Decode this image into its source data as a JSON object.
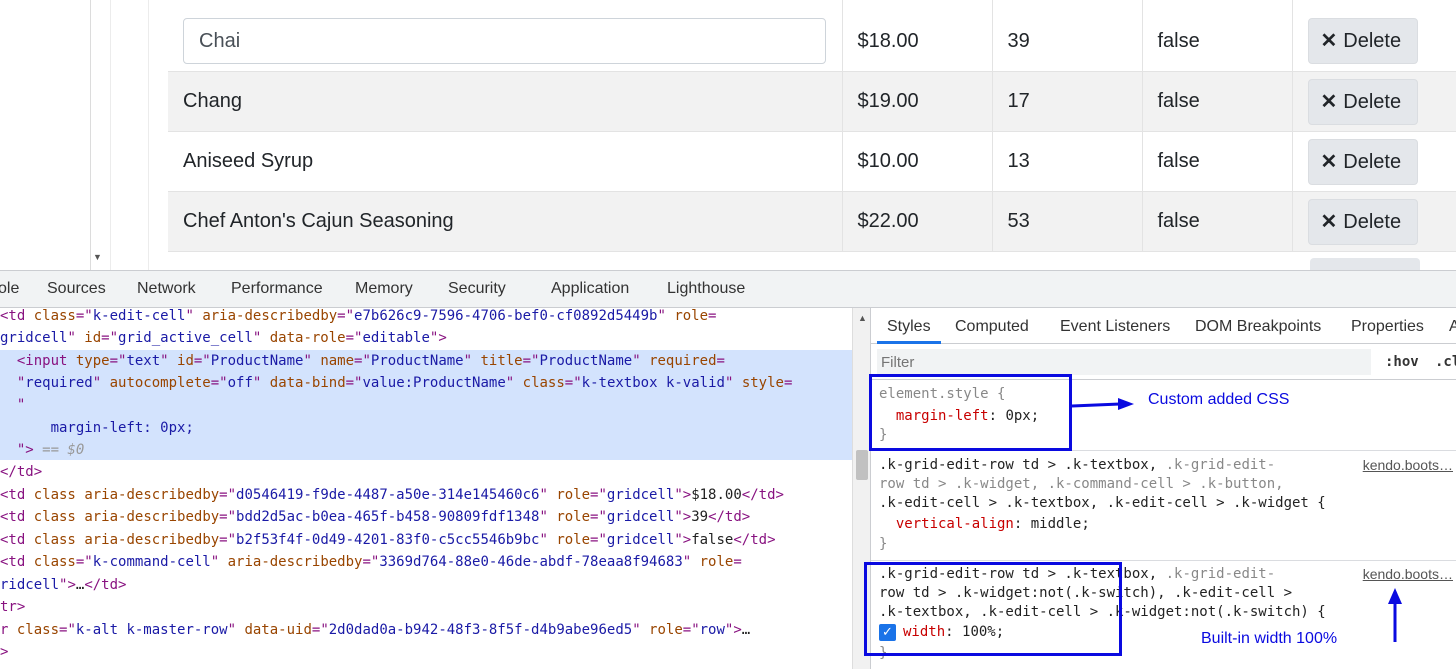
{
  "grid": {
    "rows": [
      {
        "name": "Chai",
        "price": "$18.00",
        "stock": "39",
        "discontinued": "false",
        "editing": true
      },
      {
        "name": "Chang",
        "price": "$19.00",
        "stock": "17",
        "discontinued": "false",
        "editing": false
      },
      {
        "name": "Aniseed Syrup",
        "price": "$10.00",
        "stock": "13",
        "discontinued": "false",
        "editing": false
      },
      {
        "name": "Chef Anton's Cajun Seasoning",
        "price": "$22.00",
        "stock": "53",
        "discontinued": "false",
        "editing": false
      }
    ],
    "delete_label": "Delete"
  },
  "devtools_tabs": [
    "ole",
    "Sources",
    "Network",
    "Performance",
    "Memory",
    "Security",
    "Application",
    "Lighthouse"
  ],
  "elements": {
    "lines": [
      {
        "parts": [
          [
            "tag",
            "<td "
          ],
          [
            "attr-name",
            "class"
          ],
          [
            "tag",
            "=\""
          ],
          [
            "attr-val",
            "k-edit-cell"
          ],
          [
            "tag",
            "\" "
          ],
          [
            "attr-name",
            "aria-describedby"
          ],
          [
            "tag",
            "=\""
          ],
          [
            "attr-val",
            "e7b626c9-7596-4706-bef0-cf0892d5449b"
          ],
          [
            "tag",
            "\" "
          ],
          [
            "attr-name",
            "role"
          ],
          [
            "tag",
            "="
          ]
        ]
      },
      {
        "parts": [
          [
            "attr-val",
            "gridcell"
          ],
          [
            "tag",
            "\" "
          ],
          [
            "attr-name",
            "id"
          ],
          [
            "tag",
            "=\""
          ],
          [
            "attr-val",
            "grid_active_cell"
          ],
          [
            "tag",
            "\" "
          ],
          [
            "attr-name",
            "data-role"
          ],
          [
            "tag",
            "=\""
          ],
          [
            "attr-val",
            "editable"
          ],
          [
            "tag",
            "\">"
          ]
        ]
      },
      {
        "parts": [
          [
            "tag",
            "  <input "
          ],
          [
            "attr-name",
            "type"
          ],
          [
            "tag",
            "=\""
          ],
          [
            "attr-val",
            "text"
          ],
          [
            "tag",
            "\" "
          ],
          [
            "attr-name",
            "id"
          ],
          [
            "tag",
            "=\""
          ],
          [
            "attr-val",
            "ProductName"
          ],
          [
            "tag",
            "\" "
          ],
          [
            "attr-name",
            "name"
          ],
          [
            "tag",
            "=\""
          ],
          [
            "attr-val",
            "ProductName"
          ],
          [
            "tag",
            "\" "
          ],
          [
            "attr-name",
            "title"
          ],
          [
            "tag",
            "=\""
          ],
          [
            "attr-val",
            "ProductName"
          ],
          [
            "tag",
            "\" "
          ],
          [
            "attr-name",
            "required"
          ],
          [
            "tag",
            "="
          ]
        ]
      },
      {
        "parts": [
          [
            "tag",
            "  \""
          ],
          [
            "attr-val",
            "required"
          ],
          [
            "tag",
            "\" "
          ],
          [
            "attr-name",
            "autocomplete"
          ],
          [
            "tag",
            "=\""
          ],
          [
            "attr-val",
            "off"
          ],
          [
            "tag",
            "\" "
          ],
          [
            "attr-name",
            "data-bind"
          ],
          [
            "tag",
            "=\""
          ],
          [
            "attr-val",
            "value:ProductName"
          ],
          [
            "tag",
            "\" "
          ],
          [
            "attr-name",
            "class"
          ],
          [
            "tag",
            "=\""
          ],
          [
            "attr-val",
            "k-textbox k-valid"
          ],
          [
            "tag",
            "\" "
          ],
          [
            "attr-name",
            "style"
          ],
          [
            "tag",
            "="
          ]
        ]
      },
      {
        "parts": [
          [
            "tag",
            "  \""
          ]
        ]
      },
      {
        "parts": [
          [
            "attr-val",
            "      margin-left: 0px;"
          ]
        ]
      },
      {
        "parts": [
          [
            "tag",
            "  \">"
          ],
          [
            "dim",
            " == $0"
          ]
        ]
      },
      {
        "parts": [
          [
            "tag",
            "</td>"
          ]
        ]
      },
      {
        "parts": [
          [
            "tag",
            "<td "
          ],
          [
            "attr-name",
            "class"
          ],
          [
            "tag",
            " "
          ],
          [
            "attr-name",
            "aria-describedby"
          ],
          [
            "tag",
            "=\""
          ],
          [
            "attr-val",
            "d0546419-f9de-4487-a50e-314e145460c6"
          ],
          [
            "tag",
            "\" "
          ],
          [
            "attr-name",
            "role"
          ],
          [
            "tag",
            "=\""
          ],
          [
            "attr-val",
            "gridcell"
          ],
          [
            "tag",
            "\">"
          ],
          [
            "txt",
            "$18.00"
          ],
          [
            "tag",
            "</td>"
          ]
        ]
      },
      {
        "parts": [
          [
            "tag",
            "<td "
          ],
          [
            "attr-name",
            "class"
          ],
          [
            "tag",
            " "
          ],
          [
            "attr-name",
            "aria-describedby"
          ],
          [
            "tag",
            "=\""
          ],
          [
            "attr-val",
            "bdd2d5ac-b0ea-465f-b458-90809fdf1348"
          ],
          [
            "tag",
            "\" "
          ],
          [
            "attr-name",
            "role"
          ],
          [
            "tag",
            "=\""
          ],
          [
            "attr-val",
            "gridcell"
          ],
          [
            "tag",
            "\">"
          ],
          [
            "txt",
            "39"
          ],
          [
            "tag",
            "</td>"
          ]
        ]
      },
      {
        "parts": [
          [
            "tag",
            "<td "
          ],
          [
            "attr-name",
            "class"
          ],
          [
            "tag",
            " "
          ],
          [
            "attr-name",
            "aria-describedby"
          ],
          [
            "tag",
            "=\""
          ],
          [
            "attr-val",
            "b2f53f4f-0d49-4201-83f0-c5cc5546b9bc"
          ],
          [
            "tag",
            "\" "
          ],
          [
            "attr-name",
            "role"
          ],
          [
            "tag",
            "=\""
          ],
          [
            "attr-val",
            "gridcell"
          ],
          [
            "tag",
            "\">"
          ],
          [
            "txt",
            "false"
          ],
          [
            "tag",
            "</td>"
          ]
        ]
      },
      {
        "parts": [
          [
            "tag",
            "<td "
          ],
          [
            "attr-name",
            "class"
          ],
          [
            "tag",
            "=\""
          ],
          [
            "attr-val",
            "k-command-cell"
          ],
          [
            "tag",
            "\" "
          ],
          [
            "attr-name",
            "aria-describedby"
          ],
          [
            "tag",
            "=\""
          ],
          [
            "attr-val",
            "3369d764-88e0-46de-abdf-78eaa8f94683"
          ],
          [
            "tag",
            "\" "
          ],
          [
            "attr-name",
            "role"
          ],
          [
            "tag",
            "="
          ]
        ]
      },
      {
        "parts": [
          [
            "attr-val",
            "ridcell"
          ],
          [
            "tag",
            "\">"
          ],
          [
            "txt",
            "…"
          ],
          [
            "tag",
            "</td>"
          ]
        ]
      },
      {
        "parts": [
          [
            "tag",
            "tr>"
          ]
        ]
      },
      {
        "parts": [
          [
            "tag",
            "r "
          ],
          [
            "attr-name",
            "class"
          ],
          [
            "tag",
            "=\""
          ],
          [
            "attr-val",
            "k-alt k-master-row"
          ],
          [
            "tag",
            "\" "
          ],
          [
            "attr-name",
            "data-uid"
          ],
          [
            "tag",
            "=\""
          ],
          [
            "attr-val",
            "2d0dad0a-b942-48f3-8f5f-d4b9abe96ed5"
          ],
          [
            "tag",
            "\" "
          ],
          [
            "attr-name",
            "role"
          ],
          [
            "tag",
            "=\""
          ],
          [
            "attr-val",
            "row"
          ],
          [
            "tag",
            "\">"
          ],
          [
            "txt",
            "…"
          ]
        ]
      },
      {
        "parts": [
          [
            "tag",
            ">"
          ]
        ]
      }
    ]
  },
  "styles_panel": {
    "tabs": [
      "Styles",
      "Computed",
      "Event Listeners",
      "DOM Breakpoints",
      "Properties",
      "A"
    ],
    "filter_placeholder": "Filter",
    "hov": ":hov",
    "cls": ".cl",
    "rule1": {
      "l1": "element.style {",
      "prop": "margin-left",
      "value": " 0px;",
      "l3": "}"
    },
    "rule2": {
      "l1a": ".k-grid-edit-row td > .k-textbox,",
      "l1b": " .k-grid-edit-",
      "l2": "row td > .k-widget, .k-command-cell > .k-button,",
      "l3": ".k-edit-cell > .k-textbox, .k-edit-cell > .k-widget {",
      "prop": "vertical-align",
      "value": " middle;",
      "l5": "}",
      "source": "kendo.boots…"
    },
    "rule3": {
      "l1a": ".k-grid-edit-row td > .k-textbox,",
      "l1b": " .k-grid-edit-",
      "l2": "row td > .k-widget:not(.k-switch), .k-edit-cell >",
      "l3": ".k-textbox, .k-edit-cell > .k-widget:not(.k-switch) {",
      "prop": "width",
      "value": " 100%;",
      "l5": "}",
      "source": "kendo.boots…"
    }
  },
  "annotations": {
    "custom": "Custom added CSS",
    "builtin": "Built-in width 100%",
    "color": "#0a0ae0"
  }
}
